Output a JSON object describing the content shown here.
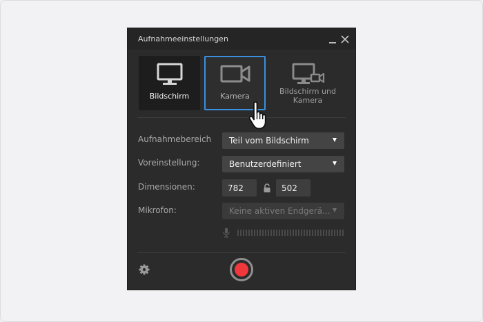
{
  "window": {
    "title": "Aufnahmeeinstellungen"
  },
  "modes": [
    {
      "label": "Bildschirm",
      "state": "active",
      "icon": "monitor-icon"
    },
    {
      "label": "Kamera",
      "state": "hover",
      "icon": "video-camera-icon"
    },
    {
      "label": "Bildschirm und Kamera",
      "state": "default",
      "icon": "monitor-camera-icon"
    }
  ],
  "settings": {
    "area_label": "Aufnahmebereich",
    "area_value": "Teil vom Bildschirm",
    "preset_label": "Voreinstellung:",
    "preset_value": "Benutzerdefiniert",
    "dimensions_label": "Dimensionen:",
    "width": "782",
    "height": "502",
    "microphone_label": "Mikrofon:",
    "microphone_value": "Keine aktiven Endgerä..."
  },
  "icons": {
    "settings": "gear-icon",
    "record": "record-button",
    "lock": "lock-icon",
    "microphone": "microphone-icon"
  },
  "colors": {
    "accent": "#3b8fe0",
    "record": "#f0383c",
    "panel": "#2b2b2b"
  }
}
